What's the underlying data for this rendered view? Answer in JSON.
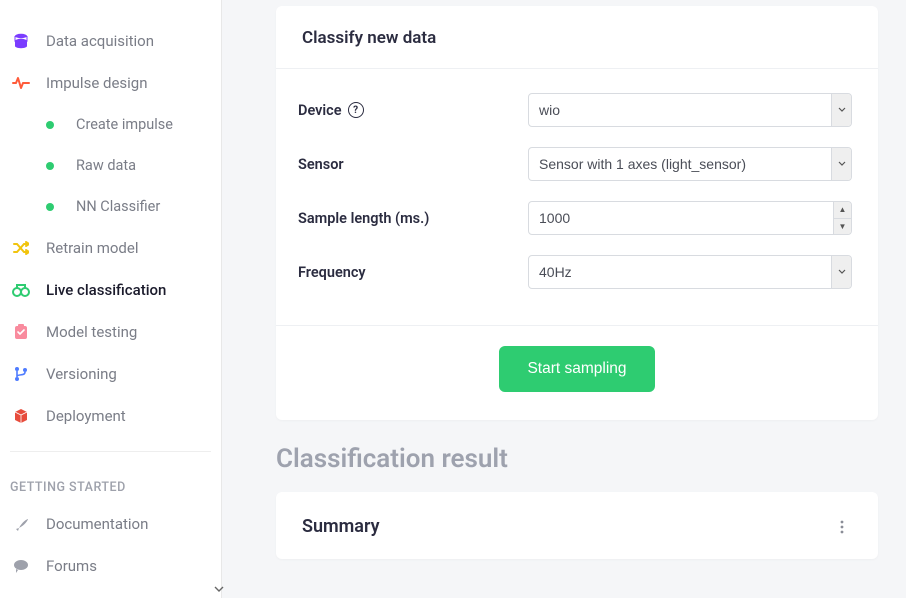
{
  "sidebar": {
    "items": [
      {
        "label": "Data acquisition",
        "icon": "database",
        "color": "#7a3cff"
      },
      {
        "label": "Impulse design",
        "icon": "pulse",
        "color": "#ff5b3a"
      },
      {
        "label": "Retrain model",
        "icon": "shuffle",
        "color": "#f1c40f"
      },
      {
        "label": "Live classification",
        "icon": "binoculars",
        "color": "#2ecc71",
        "active": true
      },
      {
        "label": "Model testing",
        "icon": "clipboard",
        "color": "#f98b9e"
      },
      {
        "label": "Versioning",
        "icon": "branch",
        "color": "#4f7cff"
      },
      {
        "label": "Deployment",
        "icon": "cube",
        "color": "#e74c3c"
      }
    ],
    "sub_items": [
      {
        "label": "Create impulse"
      },
      {
        "label": "Raw data"
      },
      {
        "label": "NN Classifier"
      }
    ],
    "getting_started_label": "GETTING STARTED",
    "gs_items": [
      {
        "label": "Documentation",
        "icon": "rocket"
      },
      {
        "label": "Forums",
        "icon": "chat"
      }
    ]
  },
  "card": {
    "title": "Classify new data",
    "device_label": "Device",
    "sensor_label": "Sensor",
    "sample_length_label": "Sample length (ms.)",
    "frequency_label": "Frequency",
    "device_value": "wio",
    "sensor_value": "Sensor with 1 axes (light_sensor)",
    "sample_length_value": "1000",
    "frequency_value": "40Hz",
    "start_button": "Start sampling"
  },
  "result": {
    "heading": "Classification result",
    "summary_title": "Summary"
  }
}
